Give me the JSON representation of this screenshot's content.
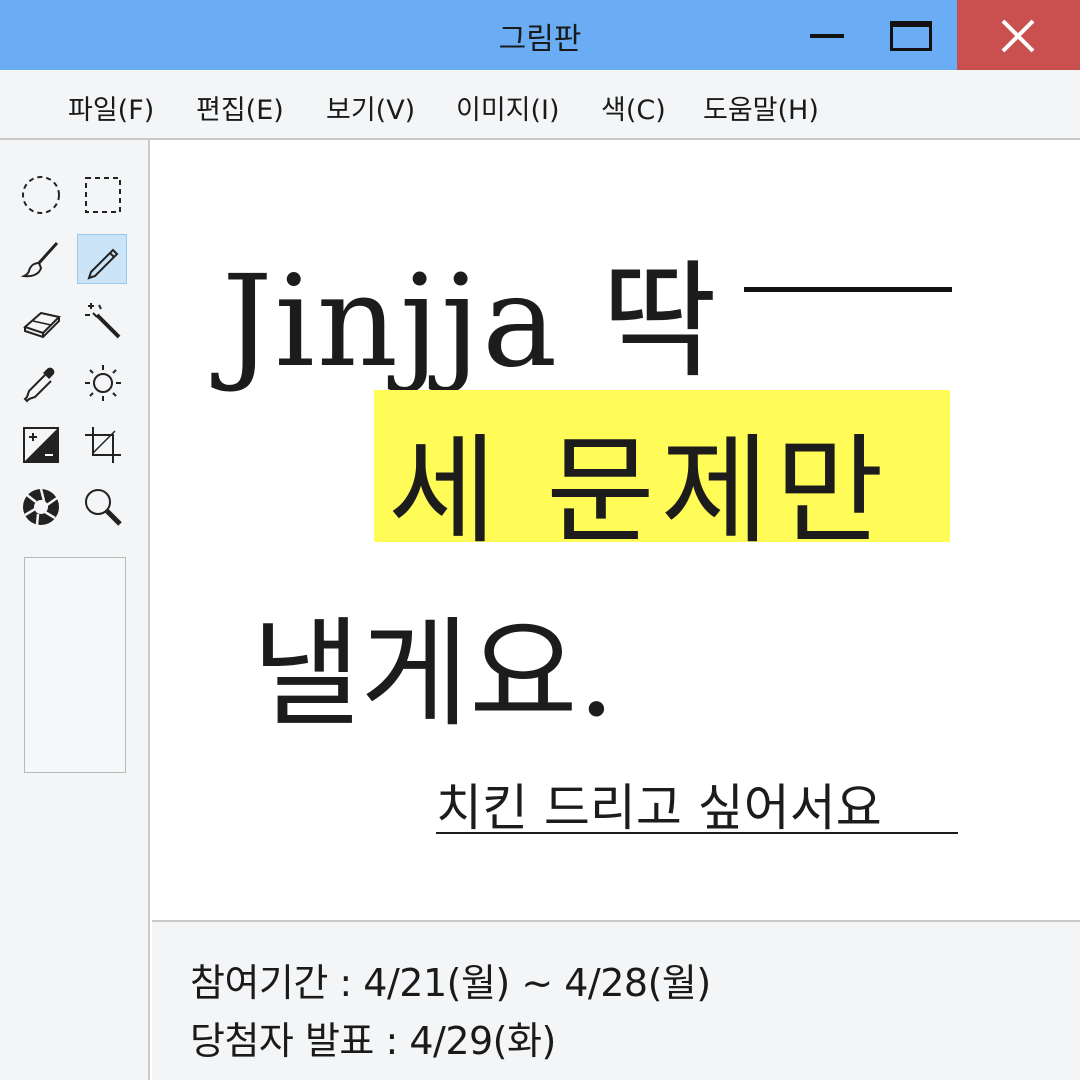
{
  "window": {
    "title": "그림판"
  },
  "menu": {
    "items": [
      "파일(F)",
      "편집(E)",
      "보기(V)",
      "이미지(I)",
      "색(C)",
      "도움말(H)"
    ]
  },
  "toolbox": {
    "tools": [
      {
        "name": "ellipse-select-icon"
      },
      {
        "name": "rect-select-icon"
      },
      {
        "name": "brush-icon"
      },
      {
        "name": "pencil-icon",
        "selected": true
      },
      {
        "name": "eraser-icon"
      },
      {
        "name": "magic-wand-icon"
      },
      {
        "name": "eyedropper-icon"
      },
      {
        "name": "brightness-icon"
      },
      {
        "name": "contrast-icon"
      },
      {
        "name": "crop-icon"
      },
      {
        "name": "aperture-icon"
      },
      {
        "name": "magnifier-icon"
      }
    ],
    "selected_color": "#f6f7f8"
  },
  "canvas": {
    "line1": "Jinjja 딱",
    "line2": "세 문제만",
    "line3": "낼게요.",
    "subline": "치킨 드리고 싶어서요",
    "highlight_color": "#fffb57"
  },
  "info": {
    "period": "참여기간 : 4/21(월) ~ 4/28(월)",
    "announcement": "당첨자 발표 : 4/29(화)"
  },
  "colors": {
    "titlebar": "#6aadf5",
    "close_button": "#c9504f",
    "panel": "#f4f5f7",
    "selection": "#cce4f7"
  }
}
